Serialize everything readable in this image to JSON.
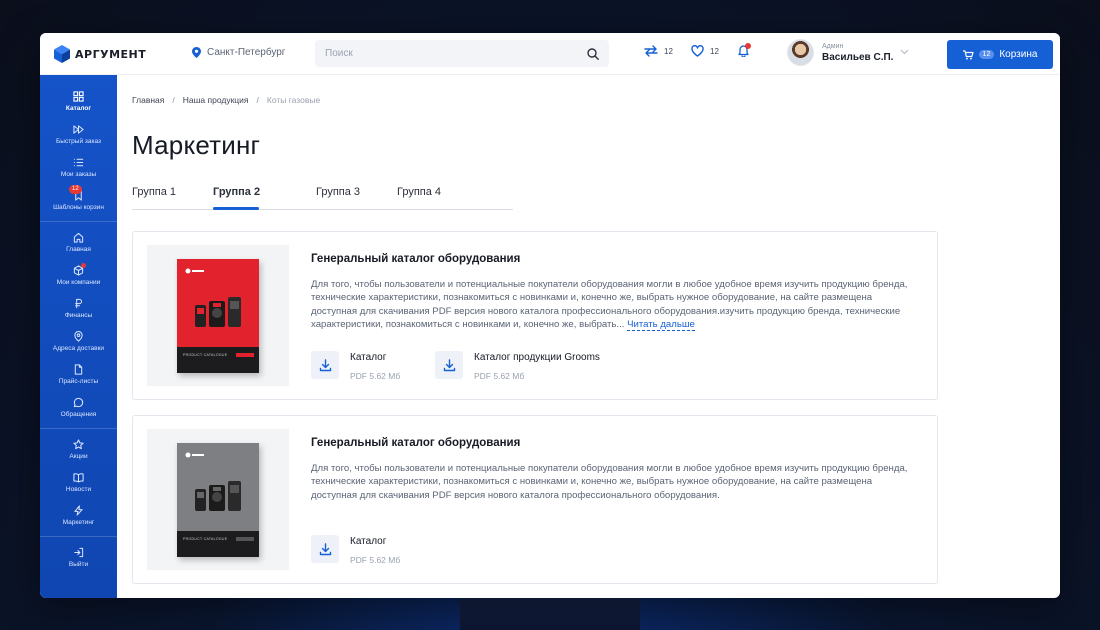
{
  "brand": {
    "logo_text": "АРГУМЕНТ",
    "accent": "#1660d6"
  },
  "header": {
    "city": "Санкт-Петербург",
    "search_placeholder": "Поиск",
    "compare_count": "12",
    "favorites_count": "12",
    "user_role": "Админ",
    "user_name": "Васильев С.П.",
    "cart_label": "Корзина",
    "cart_count": "12"
  },
  "sidebar": {
    "items": [
      {
        "label": "Каталог",
        "icon": "grid-icon"
      },
      {
        "label": "Быстрый заказ",
        "icon": "fast-forward-icon"
      },
      {
        "label": "Мои заказы",
        "icon": "list-icon"
      },
      {
        "label": "Шаблоны корзин",
        "icon": "bookmark-icon",
        "badge": "12"
      },
      {
        "label": "Главная",
        "icon": "home-icon"
      },
      {
        "label": "Мои компании",
        "icon": "cube-icon"
      },
      {
        "label": "Финансы",
        "icon": "ruble-icon"
      },
      {
        "label": "Адреса доставки",
        "icon": "pin-icon"
      },
      {
        "label": "Прайс-листы",
        "icon": "file-icon"
      },
      {
        "label": "Обращения",
        "icon": "chat-icon"
      },
      {
        "label": "Акции",
        "icon": "star-icon"
      },
      {
        "label": "Новости",
        "icon": "book-icon"
      },
      {
        "label": "Маркетинг",
        "icon": "bolt-icon"
      },
      {
        "label": "Выйти",
        "icon": "logout-icon"
      }
    ]
  },
  "breadcrumb": [
    "Главная",
    "Наша продукция",
    "Коты газовые"
  ],
  "page_title": "Маркетинг",
  "tabs": [
    "Группа 1",
    "Группа 2",
    "Группа 3",
    "Группа 4"
  ],
  "cards": [
    {
      "title": "Генеральный каталог оборудования",
      "description": "Для того, чтобы пользователи и потенциальные покупатели оборудования могли в любое удобное время изучить продукцию бренда, технические характеристики, познакомиться с новинками и, конечно же, выбрать нужное оборудование, на сайте размещена доступная для скачивания PDF версия нового каталога профессионального оборудования.изучить продукцию бренда, технические характеристики, познакомиться с новинками и, конечно же, выбрать...",
      "read_more": "Читать дальше",
      "files": [
        {
          "name": "Каталог",
          "meta": "PDF 5.62 Мб"
        },
        {
          "name": "Каталог продукции Grooms",
          "meta": "PDF 5.62 Мб"
        }
      ]
    },
    {
      "title": "Генеральный каталог оборудования",
      "description": "Для того, чтобы пользователи и потенциальные покупатели оборудования могли в любое удобное время изучить продукцию бренда, технические характеристики, познакомиться с новинками и, конечно же, выбрать нужное оборудование, на сайте размещена доступная для скачивания PDF версия нового каталога профессионального оборудования.",
      "files": [
        {
          "name": "Каталог",
          "meta": "PDF 5.62 Мб"
        }
      ]
    }
  ]
}
